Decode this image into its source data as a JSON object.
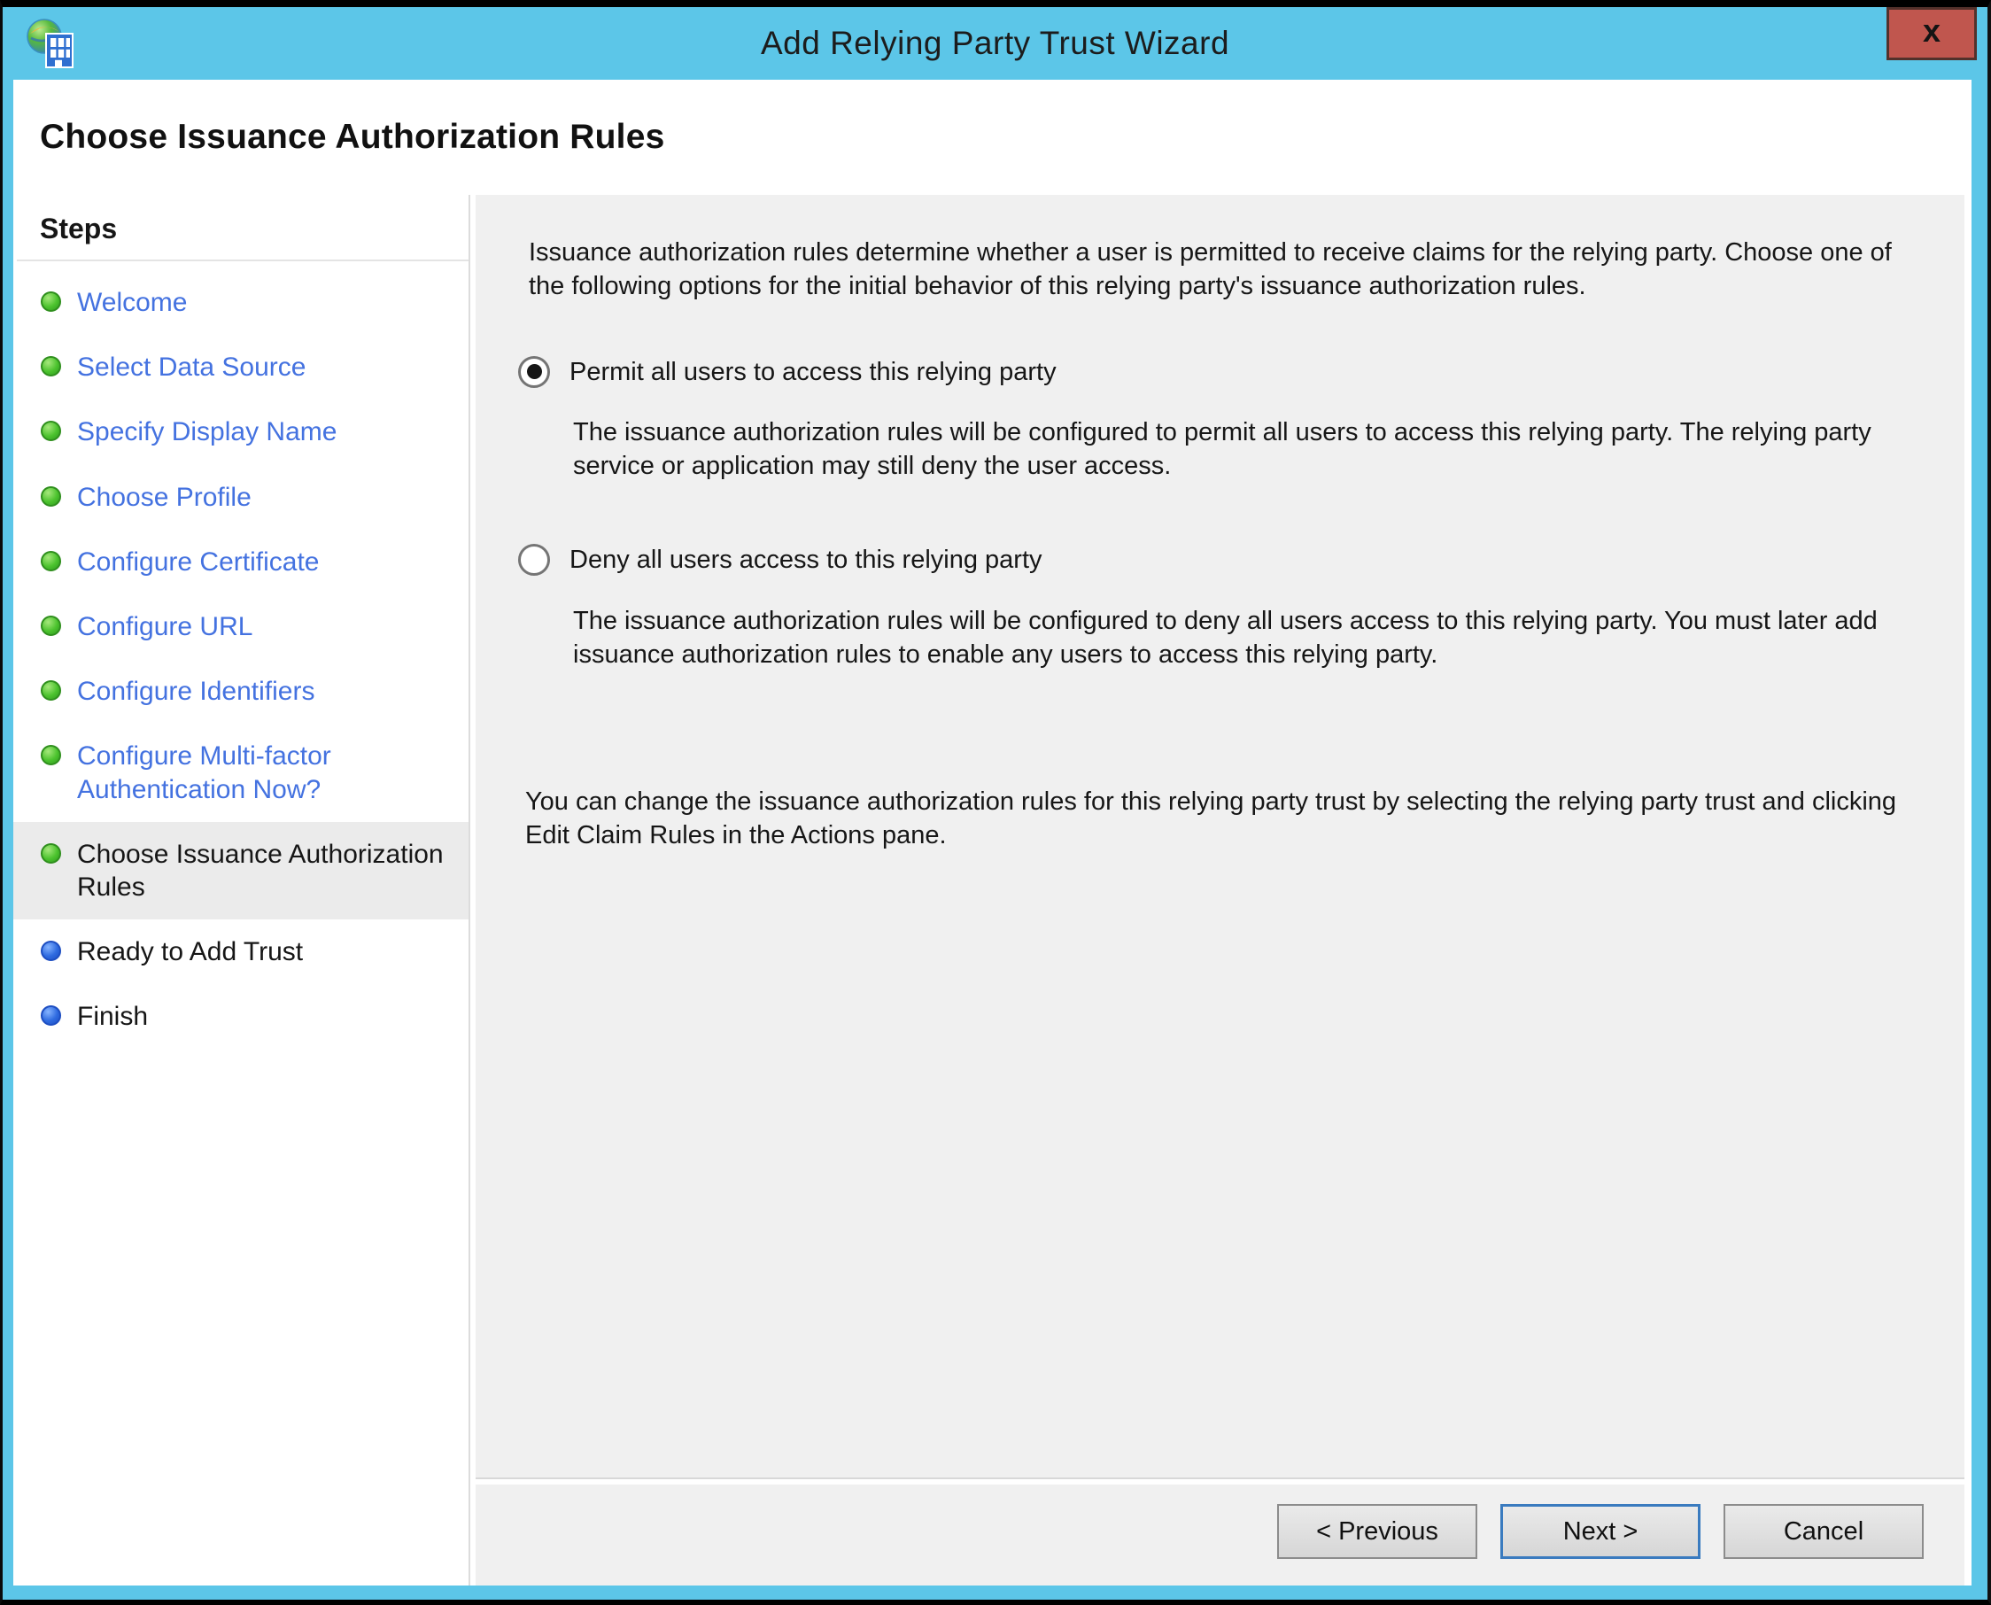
{
  "window": {
    "title": "Add Relying Party Trust Wizard",
    "close_label": "x"
  },
  "page": {
    "heading": "Choose Issuance Authorization Rules"
  },
  "sidebar": {
    "heading": "Steps",
    "items": [
      {
        "label": "Welcome",
        "status": "done"
      },
      {
        "label": "Select Data Source",
        "status": "done"
      },
      {
        "label": "Specify Display Name",
        "status": "done"
      },
      {
        "label": "Choose Profile",
        "status": "done"
      },
      {
        "label": "Configure Certificate",
        "status": "done"
      },
      {
        "label": "Configure URL",
        "status": "done"
      },
      {
        "label": "Configure Identifiers",
        "status": "done"
      },
      {
        "label": "Configure Multi-factor Authentication Now?",
        "status": "done"
      },
      {
        "label": "Choose Issuance Authorization Rules",
        "status": "current"
      },
      {
        "label": "Ready to Add Trust",
        "status": "pending"
      },
      {
        "label": "Finish",
        "status": "pending"
      }
    ]
  },
  "content": {
    "intro": "Issuance authorization rules determine whether a user is permitted to receive claims for the relying party. Choose one of the following options for the initial behavior of this relying party's issuance authorization rules.",
    "options": [
      {
        "label": "Permit all users to access this relying party",
        "selected": true,
        "description": "The issuance authorization rules will be configured to permit all users to access this relying party. The relying party service or application may still deny the user access."
      },
      {
        "label": "Deny all users access to this relying party",
        "selected": false,
        "description": "The issuance authorization rules will be configured to deny all users access to this relying party. You must later add issuance authorization rules to enable any users to access this relying party."
      }
    ],
    "note": "You can change the issuance authorization rules for this relying party trust by selecting the relying party trust and clicking Edit Claim Rules in the Actions pane."
  },
  "buttons": {
    "previous": "< Previous",
    "next": "Next >",
    "cancel": "Cancel"
  },
  "colors": {
    "titlebar_blue": "#5cc6e8",
    "close_red": "#c0564e",
    "link_blue": "#4472e0",
    "done_dot_green": "#4cc32e",
    "pending_dot_blue": "#2f6be0",
    "content_gray": "#f0f0f0",
    "current_step_highlight": "#ebebeb",
    "default_button_border": "#3a7bbf"
  }
}
